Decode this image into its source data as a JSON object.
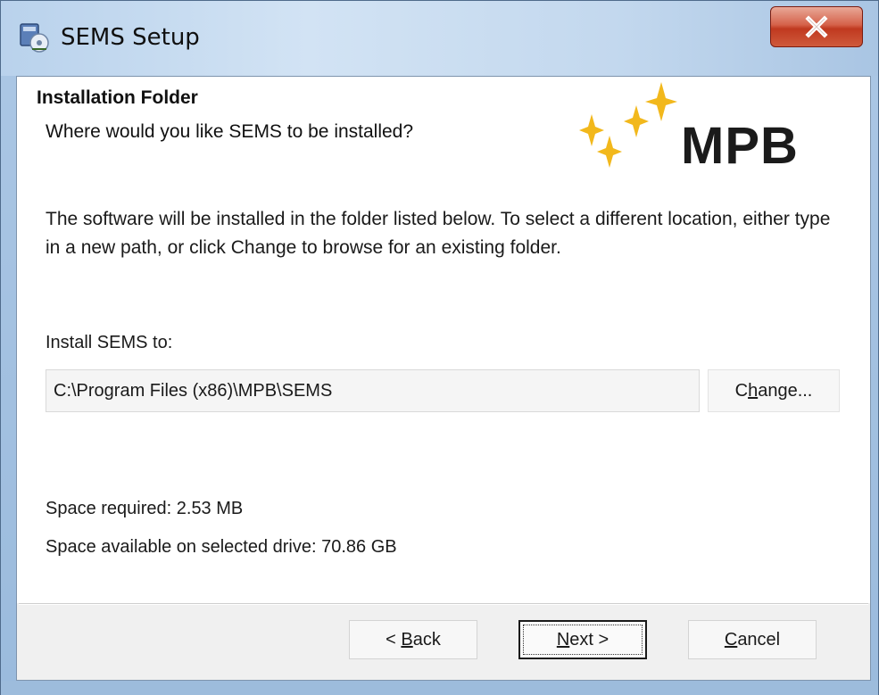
{
  "window": {
    "title": "SEMS Setup",
    "close_label": "X"
  },
  "banner": {
    "heading": "Installation Folder",
    "subheading": "Where would you like SEMS to be installed?",
    "logo_text": "MPB",
    "logo_star_color": "#f2b81c"
  },
  "body": {
    "description": "The software will be installed in the folder listed below. To select a different location, either type in a new path, or click Change to browse for an existing folder.",
    "install_label": "Install SEMS to:",
    "install_path": "C:\\Program Files (x86)\\MPB\\SEMS",
    "change_button": {
      "accel": "h",
      "pre": "C",
      "post": "ange..."
    },
    "space_required": "Space required: 2.53 MB",
    "space_available": "Space available on selected drive: 70.86 GB"
  },
  "buttons": {
    "back": {
      "pre": "< ",
      "accel": "B",
      "post": "ack"
    },
    "next": {
      "pre": "",
      "accel": "N",
      "post": "ext >"
    },
    "cancel": {
      "pre": "",
      "accel": "C",
      "post": "ancel"
    }
  },
  "icons": [
    "setup-app-icon",
    "close-icon",
    "mpb-star-icon"
  ]
}
